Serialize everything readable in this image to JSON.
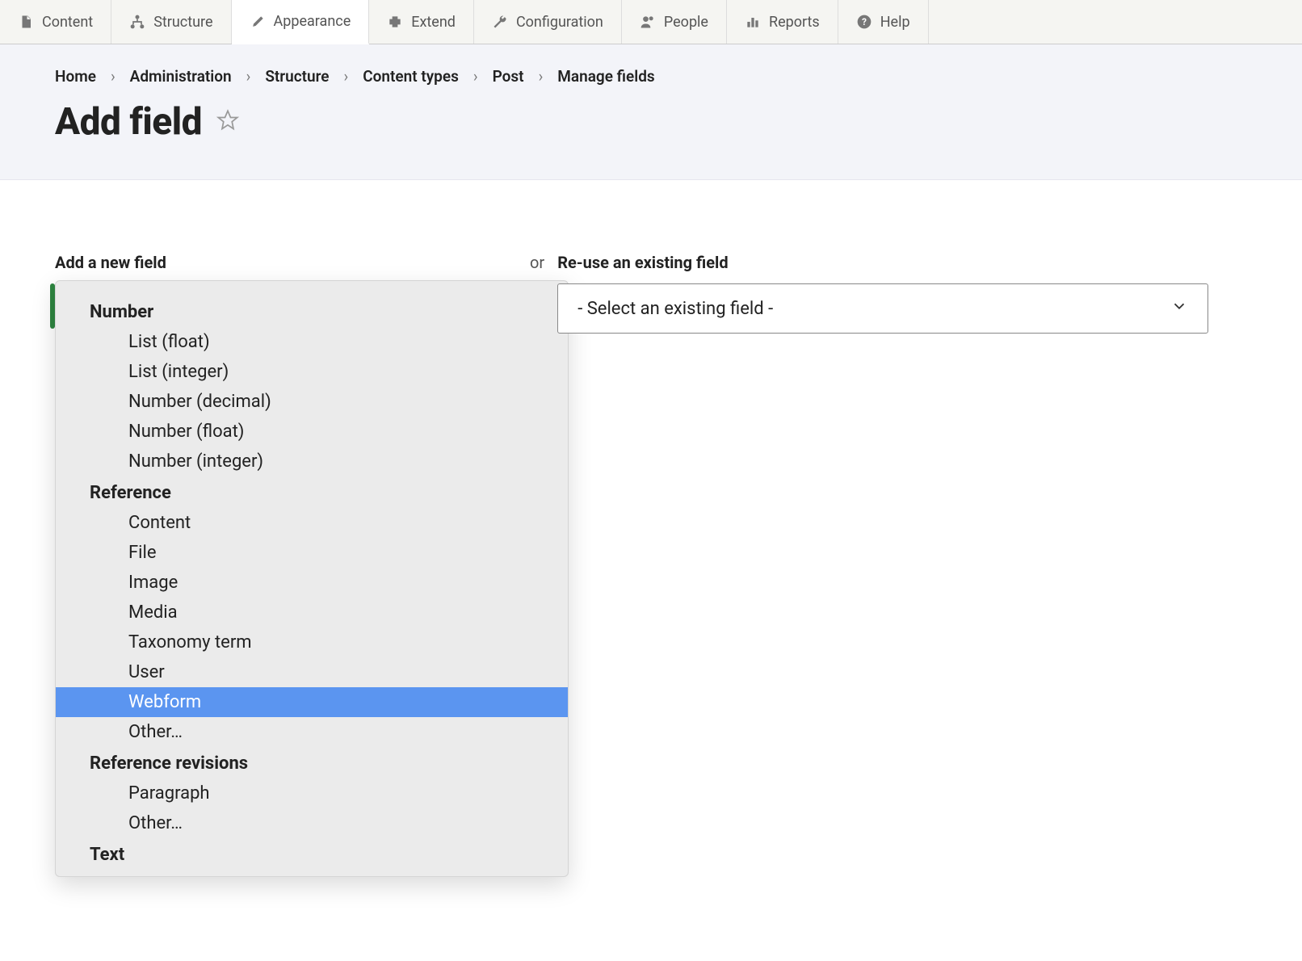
{
  "toolbar": [
    {
      "key": "content",
      "label": "Content"
    },
    {
      "key": "structure",
      "label": "Structure"
    },
    {
      "key": "appearance",
      "label": "Appearance"
    },
    {
      "key": "extend",
      "label": "Extend"
    },
    {
      "key": "configuration",
      "label": "Configuration"
    },
    {
      "key": "people",
      "label": "People"
    },
    {
      "key": "reports",
      "label": "Reports"
    },
    {
      "key": "help",
      "label": "Help"
    }
  ],
  "breadcrumb": [
    "Home",
    "Administration",
    "Structure",
    "Content types",
    "Post",
    "Manage fields"
  ],
  "page_title": "Add field",
  "form": {
    "new_field_label": "Add a new field",
    "or_text": "or",
    "existing_field_label": "Re-use an existing field",
    "existing_field_placeholder": "- Select an existing field -"
  },
  "dropdown": {
    "groups": [
      {
        "label": "Number",
        "options": [
          "List (float)",
          "List (integer)",
          "Number (decimal)",
          "Number (float)",
          "Number (integer)"
        ]
      },
      {
        "label": "Reference",
        "options": [
          "Content",
          "File",
          "Image",
          "Media",
          "Taxonomy term",
          "User",
          "Webform",
          "Other…"
        ]
      },
      {
        "label": "Reference revisions",
        "options": [
          "Paragraph",
          "Other…"
        ]
      },
      {
        "label": "Text",
        "options": []
      }
    ],
    "highlighted": "Webform"
  }
}
